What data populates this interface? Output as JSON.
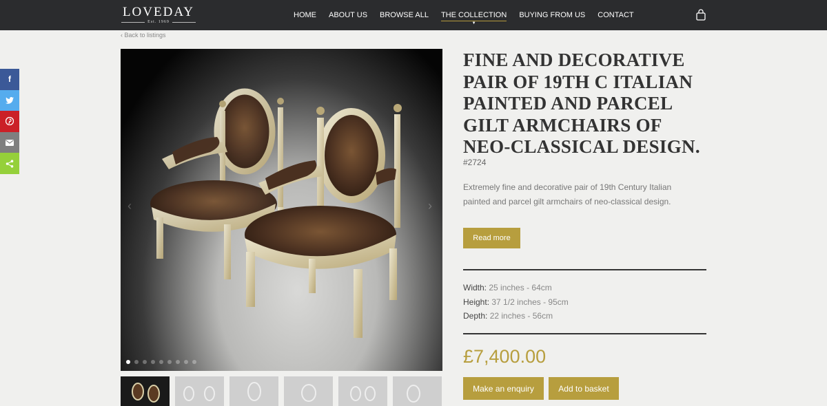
{
  "brand": {
    "name": "LOVEDAY",
    "est": "Est. 1969"
  },
  "nav": [
    {
      "label": "HOME"
    },
    {
      "label": "ABOUT US"
    },
    {
      "label": "BROWSE ALL"
    },
    {
      "label": "THE COLLECTION",
      "active": true
    },
    {
      "label": "BUYING FROM US"
    },
    {
      "label": "CONTACT"
    }
  ],
  "cart_icon": "shopping-bag-icon",
  "back_link": "‹ Back to listings",
  "share": [
    {
      "icon": "facebook-icon",
      "glyph": "f"
    },
    {
      "icon": "twitter-icon",
      "glyph": "t"
    },
    {
      "icon": "pinterest-icon",
      "glyph": "p"
    },
    {
      "icon": "email-icon",
      "glyph": "✉"
    },
    {
      "icon": "share-icon",
      "glyph": "<"
    }
  ],
  "gallery": {
    "slide_count": 9,
    "active_slide": 1,
    "prev_icon": "chevron-left-icon",
    "next_icon": "chevron-right-icon",
    "thumbnail_count": 6
  },
  "product": {
    "title": "FINE AND DECORATIVE PAIR OF 19TH C ITALIAN PAINTED AND PARCEL GILT ARMCHAIRS OF NEO-CLASSICAL DESIGN.",
    "ref": "#2724",
    "description": "Extremely fine and decorative pair of 19th Century Italian painted and parcel gilt armchairs of neo-classical design.",
    "read_more": "Read more",
    "dimensions": [
      {
        "label": "Width:",
        "value": "25 inches - 64cm"
      },
      {
        "label": "Height:",
        "value": "37 1/2 inches - 95cm"
      },
      {
        "label": "Depth:",
        "value": "22 inches - 56cm"
      }
    ],
    "price": "£7,400.00",
    "enquiry_label": "Make an enquiry",
    "basket_label": "Add to basket"
  },
  "colors": {
    "header": "#2b2c2e",
    "accent": "#b79e3e",
    "background": "#f0f0ee"
  }
}
